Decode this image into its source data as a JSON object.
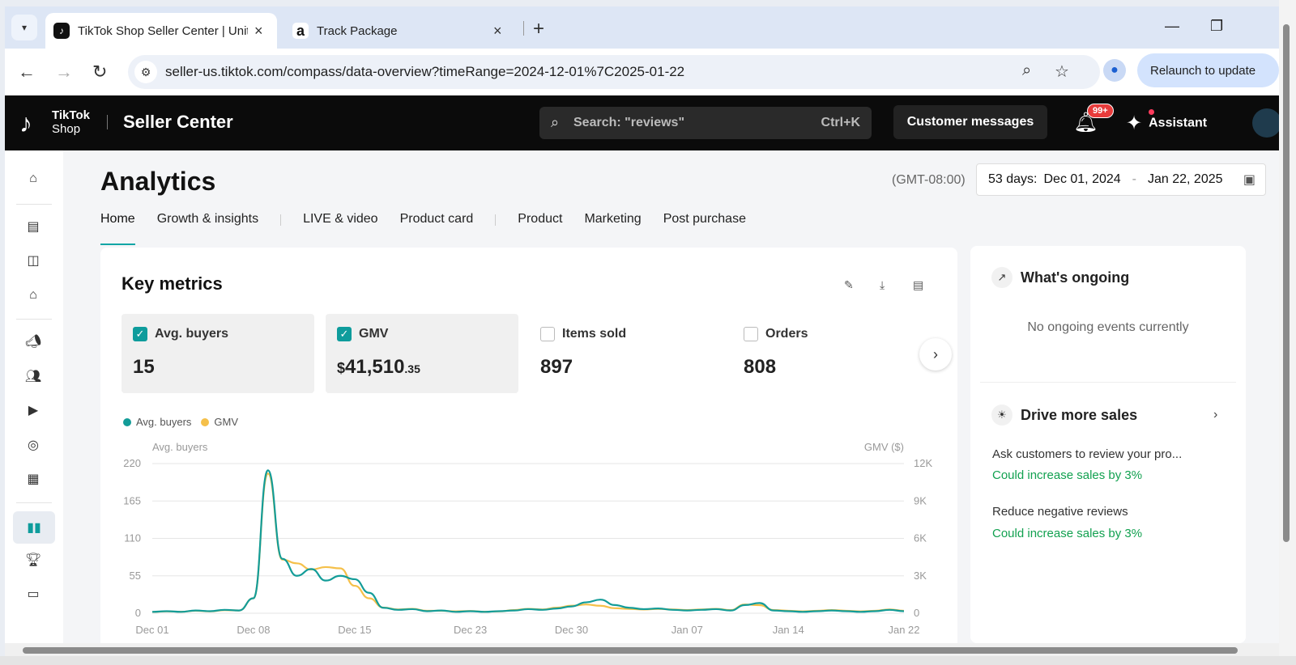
{
  "browser": {
    "tabs": [
      {
        "title": "TikTok Shop Seller Center | Unit",
        "favicon": "tiktok-icon"
      },
      {
        "title": "Track Package",
        "favicon": "amazon-icon"
      }
    ],
    "url": "seller-us.tiktok.com/compass/data-overview?timeRange=2024-12-01%7C2025-01-22",
    "relaunch_label": "Relaunch to update"
  },
  "header": {
    "logo_line1": "TikTok",
    "logo_line2": "Shop",
    "product": "Seller Center",
    "search_placeholder": "Search: \"reviews\"",
    "search_shortcut": "Ctrl+K",
    "customer_messages": "Customer messages",
    "notification_count": "99+",
    "assistant": "Assistant"
  },
  "page": {
    "title": "Analytics",
    "timezone": "(GMT-08:00)",
    "range_days": "53 days:",
    "range_start": "Dec 01, 2024",
    "range_sep": "-",
    "range_end": "Jan 22, 2025",
    "tabs": [
      "Home",
      "Growth & insights",
      "LIVE & video",
      "Product card",
      "Product",
      "Marketing",
      "Post purchase"
    ],
    "active_tab": "Home"
  },
  "key_metrics": {
    "title": "Key metrics",
    "metrics": [
      {
        "label": "Avg. buyers",
        "value": "15",
        "checked": true
      },
      {
        "label": "GMV",
        "currency": "$",
        "value": "41,510",
        "cents": ".35",
        "checked": true
      },
      {
        "label": "Items sold",
        "value": "897",
        "checked": false
      },
      {
        "label": "Orders",
        "value": "808",
        "checked": false
      }
    ]
  },
  "colors": {
    "teal": "#139c98",
    "yellow": "#f5c04a",
    "accent": "#0fa5a5",
    "gain": "#12a150"
  },
  "chart_data": {
    "type": "line",
    "left_axis_title": "Avg. buyers",
    "right_axis_title": "GMV ($)",
    "left_ticks": [
      "220",
      "165",
      "110",
      "55",
      "0"
    ],
    "right_ticks": [
      "12K",
      "9K",
      "6K",
      "3K",
      "0"
    ],
    "ylim_left": [
      0,
      220
    ],
    "ylim_right": [
      0,
      12000
    ],
    "x_tick_labels": [
      "Dec 01",
      "Dec 08",
      "Dec 15",
      "Dec 23",
      "Dec 30",
      "Jan 07",
      "Jan 14",
      "Jan 22"
    ],
    "x_tick_index": [
      0,
      7,
      14,
      22,
      29,
      37,
      44,
      52
    ],
    "legend": [
      "Avg. buyers",
      "GMV"
    ],
    "series": [
      {
        "name": "Avg. buyers",
        "color": "#139c98",
        "values": [
          2,
          3,
          2,
          4,
          3,
          5,
          4,
          22,
          210,
          80,
          55,
          65,
          48,
          55,
          50,
          30,
          8,
          5,
          6,
          3,
          4,
          2,
          3,
          2,
          3,
          4,
          6,
          5,
          7,
          10,
          16,
          20,
          12,
          8,
          6,
          7,
          5,
          4,
          5,
          6,
          4,
          12,
          15,
          4,
          3,
          2,
          3,
          4,
          3,
          2,
          3,
          5,
          3
        ]
      },
      {
        "name": "GMV",
        "color": "#f5c04a",
        "values": [
          100,
          150,
          120,
          200,
          150,
          250,
          220,
          1200,
          11200,
          4300,
          4000,
          3500,
          3700,
          3600,
          2200,
          1200,
          450,
          300,
          350,
          200,
          200,
          150,
          180,
          120,
          150,
          250,
          350,
          300,
          450,
          600,
          700,
          600,
          400,
          350,
          300,
          350,
          300,
          250,
          300,
          350,
          250,
          700,
          650,
          250,
          200,
          150,
          200,
          250,
          200,
          150,
          200,
          300,
          200
        ]
      }
    ]
  },
  "side": {
    "ongoing_title": "What's ongoing",
    "ongoing_empty": "No ongoing events currently",
    "drive_title": "Drive more sales",
    "suggestions": [
      {
        "title": "Ask customers to review your pro...",
        "gain": "Could increase sales by 3%"
      },
      {
        "title": "Reduce negative reviews",
        "gain": "Could increase sales by 3%"
      }
    ]
  }
}
